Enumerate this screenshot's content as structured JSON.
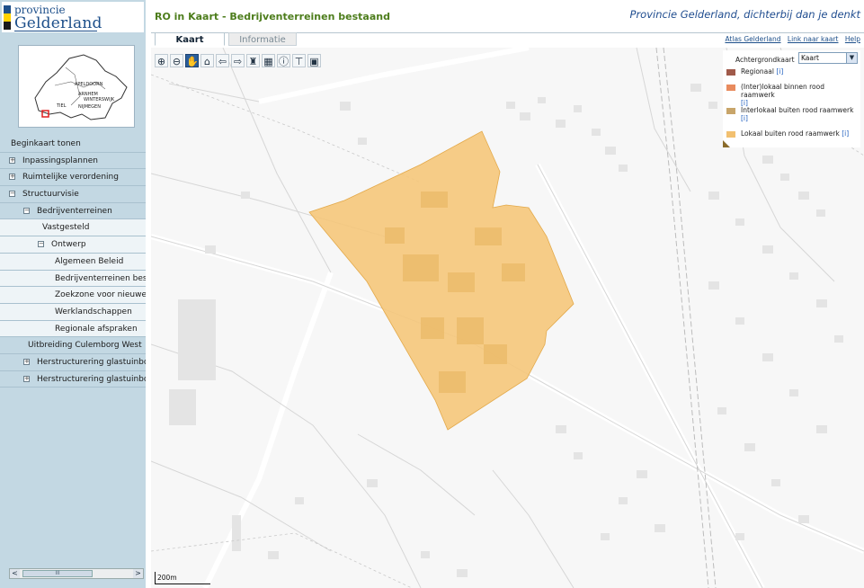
{
  "logo": {
    "line1": "provincie",
    "line2": "Gelderland",
    "colors": [
      "#1d4f8a",
      "#ffd200",
      "#1a1a1a"
    ]
  },
  "overview_map": {
    "labels": [
      "APELDOORN",
      "ARNHEM",
      "WINTERSWIJK",
      "NIJMEGEN",
      "TIEL"
    ]
  },
  "sidebar": {
    "tree": [
      {
        "label": "Beginkaart tonen",
        "toggle": "",
        "level": 0
      },
      {
        "label": "Inpassingsplannen",
        "toggle": "+",
        "level": 0
      },
      {
        "label": "Ruimtelijke verordening",
        "toggle": "+",
        "level": 0
      },
      {
        "label": "Structuurvisie",
        "toggle": "−",
        "level": 0
      },
      {
        "label": "Bedrijventerreinen",
        "toggle": "−",
        "level": 1
      },
      {
        "label": "Vastgesteld",
        "toggle": "",
        "level": 2
      },
      {
        "label": "Ontwerp",
        "toggle": "−",
        "level": 2
      },
      {
        "label": "Algemeen Beleid",
        "toggle": "",
        "level": 3
      },
      {
        "label": "Bedrijventerreinen bestaand",
        "toggle": "",
        "level": 3
      },
      {
        "label": "Zoekzone voor nieuwe bedrijventerreinen",
        "toggle": "",
        "level": 3
      },
      {
        "label": "Werklandschappen",
        "toggle": "",
        "level": 3
      },
      {
        "label": "Regionale afspraken",
        "toggle": "",
        "level": 3
      },
      {
        "label": "Uitbreiding Culemborg West",
        "toggle": "",
        "level": 1
      },
      {
        "label": "Herstructurering glastuinbouw",
        "toggle": "+",
        "level": 1
      },
      {
        "label": "Herstructurering glastuinbouw",
        "toggle": "+",
        "level": 1
      }
    ],
    "scroll_left": "<",
    "scroll_right": ">",
    "scroll_thumb": "III"
  },
  "header": {
    "title": "RO in Kaart - Bedrijventerreinen bestaand",
    "slogan": "Provincie Gelderland, dichterbij dan je denkt"
  },
  "tabs": [
    {
      "label": "Kaart",
      "active": true
    },
    {
      "label": "Informatie",
      "active": false
    }
  ],
  "toplinks": [
    "Atlas Gelderland",
    "Link naar kaart",
    "Help"
  ],
  "toolbar": [
    {
      "icon": "zoom-in-icon",
      "glyph": "⊕"
    },
    {
      "icon": "zoom-out-icon",
      "glyph": "⊖"
    },
    {
      "icon": "pan-hand-icon",
      "glyph": "✋",
      "active": true
    },
    {
      "icon": "zoom-extent-icon",
      "glyph": "⌂"
    },
    {
      "icon": "back-arrow-icon",
      "glyph": "⇦"
    },
    {
      "icon": "forward-arrow-icon",
      "glyph": "⇨"
    },
    {
      "icon": "binoculars-icon",
      "glyph": "♜"
    },
    {
      "icon": "select-area-icon",
      "glyph": "▦"
    },
    {
      "icon": "info-icon",
      "glyph": "ⓘ"
    },
    {
      "icon": "pdf-icon",
      "glyph": "⊤"
    },
    {
      "icon": "print-icon",
      "glyph": "▣"
    }
  ],
  "legend": {
    "background_label": "Achtergrondkaart",
    "background_value": "Kaart",
    "info_marker": "[i]",
    "items": [
      {
        "label": "Regionaal",
        "color": "#a05a4a"
      },
      {
        "label": "(Inter)lokaal binnen rood raamwerk",
        "color": "#e88b5e"
      },
      {
        "label": "Interlokaal buiten rood raamwerk",
        "color": "#c8a56a"
      },
      {
        "label": "Lokaal buiten rood raamwerk",
        "color": "#f2c070"
      }
    ]
  },
  "map": {
    "area_color": "#f5c77a",
    "scale_label": "200m"
  }
}
